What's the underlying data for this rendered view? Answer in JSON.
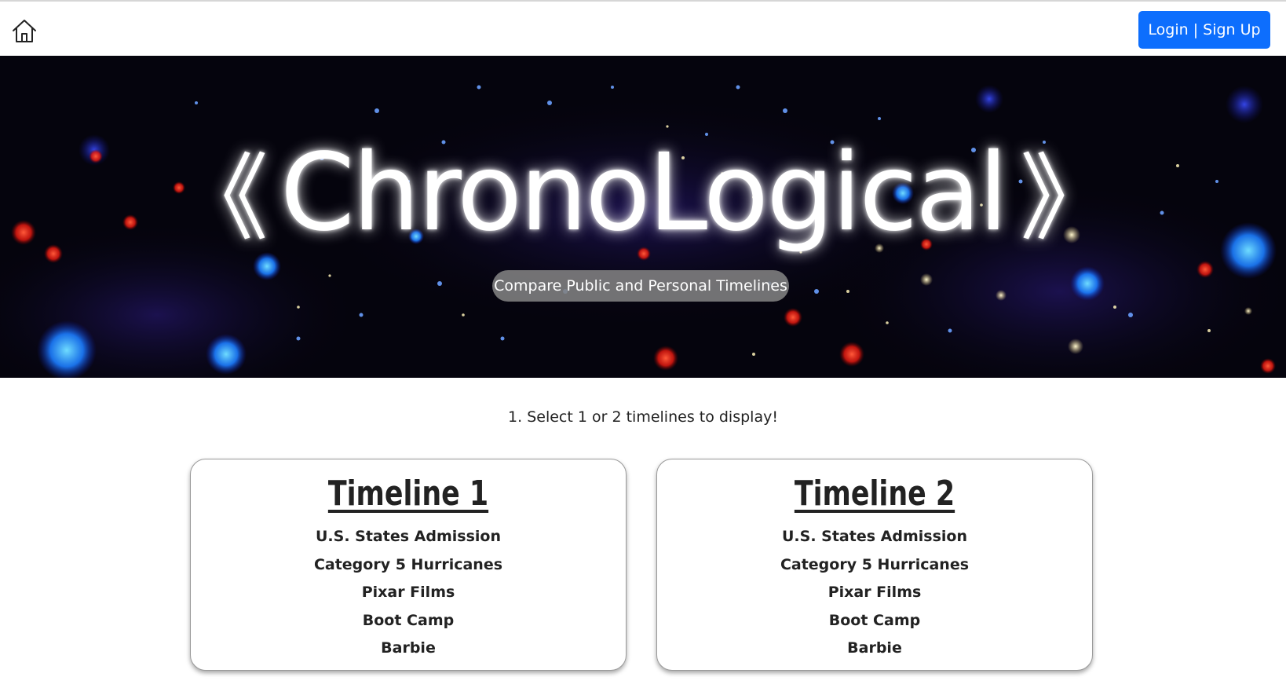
{
  "nav": {
    "login_label": "Login | Sign Up"
  },
  "hero": {
    "left_chevron": "《",
    "title": "ChronoLogical",
    "right_chevron": "》",
    "subtitle": "Compare Public and Personal Timelines"
  },
  "instruction": "1. Select 1 or 2 timelines to display!",
  "timelines": [
    {
      "title": "Timeline 1",
      "options": [
        "U.S. States Admission",
        "Category 5 Hurricanes",
        "Pixar Films",
        "Boot Camp",
        "Barbie"
      ]
    },
    {
      "title": "Timeline 2",
      "options": [
        "U.S. States Admission",
        "Category 5 Hurricanes",
        "Pixar Films",
        "Boot Camp",
        "Barbie"
      ]
    }
  ],
  "colors": {
    "accent": "#0d6efd",
    "hero_background": "#05040d"
  }
}
